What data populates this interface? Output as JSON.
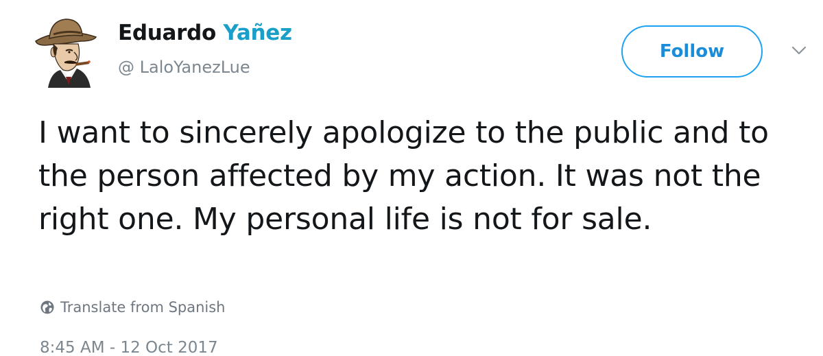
{
  "user": {
    "first_name": "Eduardo",
    "last_name": "Yañez",
    "handle": "@ LaloYanezLue"
  },
  "follow_button": {
    "label": "Follow"
  },
  "tweet": {
    "text": "I want to sincerely apologize to the public and to the person affected by my action. It was not the right one. My personal life is not for sale.",
    "translate_label": "Translate from Spanish",
    "timestamp": "8:45 AM - 12 Oct 2017"
  },
  "icons": {
    "avatar": "avatar-illustration",
    "more": "chevron-down-icon",
    "translate": "globe-icon"
  },
  "colors": {
    "accent": "#1da1f2",
    "name_highlight": "#1a9fc9",
    "muted_text": "#7b868f"
  }
}
